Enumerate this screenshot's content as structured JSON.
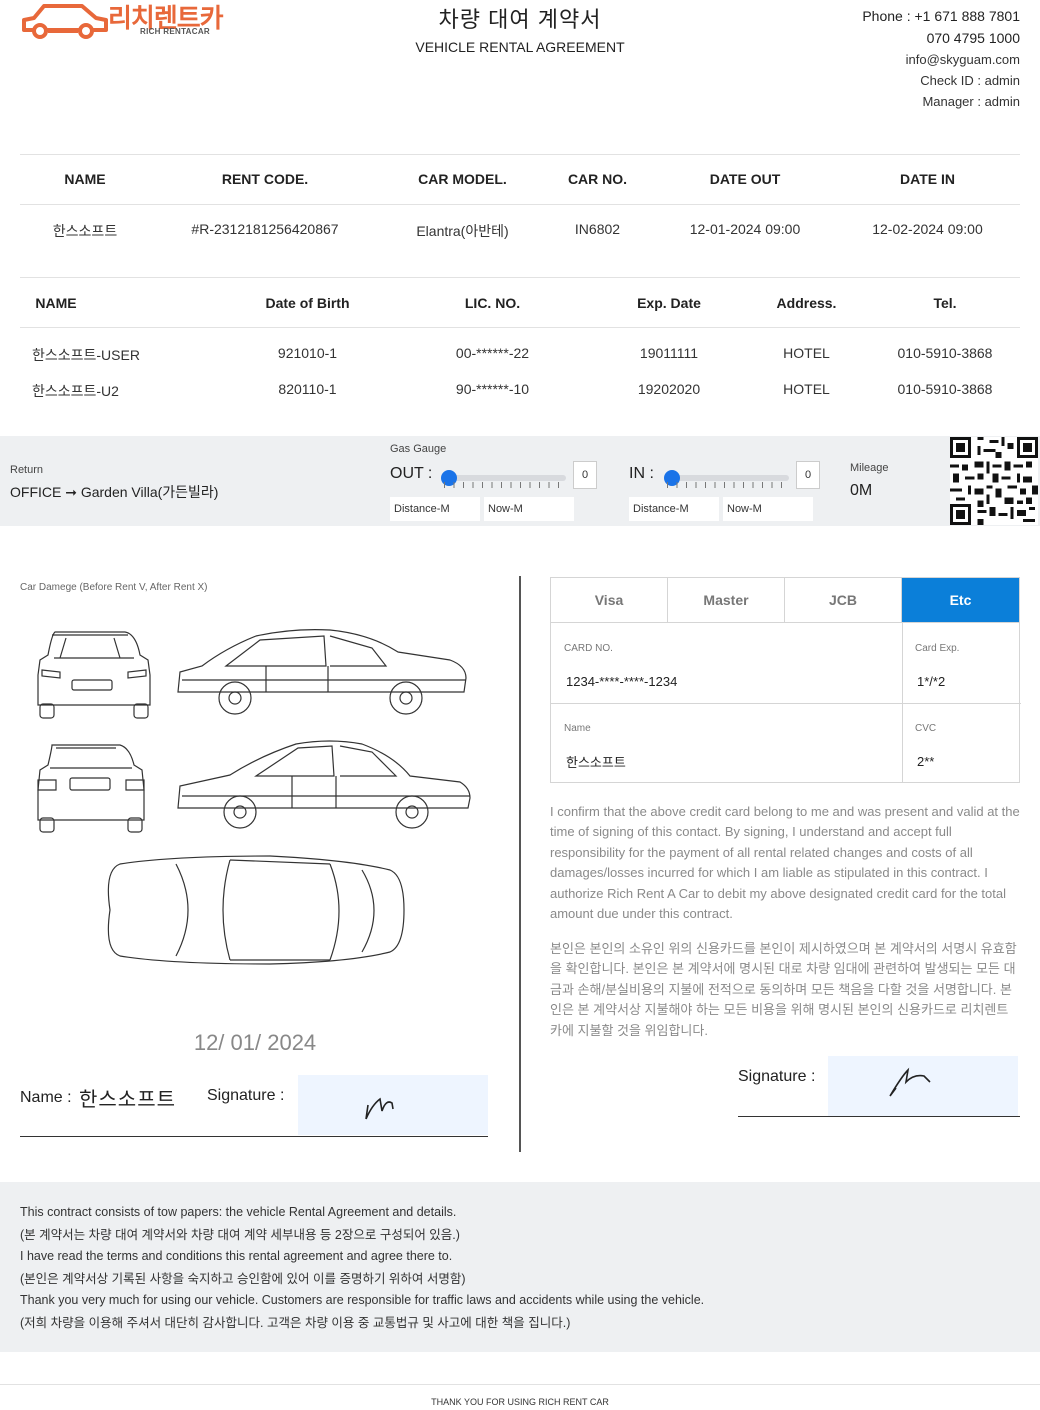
{
  "logo": {
    "kr": "리치렌트카",
    "en": "RICH RENTACAR"
  },
  "title": {
    "kr": "차량 대여 계약서",
    "en": "VEHICLE RENTAL AGREEMENT"
  },
  "contact": {
    "phone": "Phone : +1 671 888 7801",
    "phone2": "070 4795 1000",
    "email": "info@skyguam.com",
    "check_id": "Check ID : admin",
    "manager": "Manager : admin"
  },
  "rental_table": {
    "headers": [
      "NAME",
      "RENT CODE.",
      "CAR MODEL.",
      "CAR NO.",
      "DATE OUT",
      "DATE IN"
    ],
    "row": [
      "한스소프트",
      "#R-2312181256420867",
      "Elantra(아반테)",
      "IN6802",
      "12-01-2024 09:00",
      "12-02-2024 09:00"
    ]
  },
  "driver_table": {
    "headers": [
      "NAME",
      "Date of Birth",
      "LIC. NO.",
      "Exp. Date",
      "Address.",
      "Tel."
    ],
    "rows": [
      [
        "한스소프트-USER",
        "921010-1",
        "00-******-22",
        "19011111",
        "HOTEL",
        "010-5910-3868"
      ],
      [
        "한스소프트-U2",
        "820110-1",
        "90-******-10",
        "19202020",
        "HOTEL",
        "010-5910-3868"
      ]
    ]
  },
  "trip": {
    "return_label": "Return",
    "return_value": "OFFICE ➞ Garden Villa(가든빌라)",
    "gas_label": "Gas Gauge",
    "out_label": "OUT :",
    "in_label": "IN :",
    "out_value": "0",
    "in_value": "0",
    "out_fraction": 0,
    "in_fraction": 0,
    "distance_placeholder": "Distance-M",
    "now_placeholder": "Now-M",
    "mileage_label": "Mileage",
    "mileage_value": "0M"
  },
  "damage": {
    "label": "Car Damege (Before Rent V, After Rent X)",
    "date": "12/ 01/ 2024",
    "name_label": "Name :",
    "name_value": "한스소프트",
    "signature_label": "Signature :"
  },
  "card": {
    "tabs": [
      "Visa",
      "Master",
      "JCB",
      "Etc"
    ],
    "active_tab": "Etc",
    "card_no_label": "CARD NO.",
    "card_no": "1234-****-****-1234",
    "exp_label": "Card Exp.",
    "exp": "1*/*2",
    "name_label": "Name",
    "name": "한스소프트",
    "cvc_label": "CVC",
    "cvc": "2**",
    "active_color": "#0b7fd9"
  },
  "terms": {
    "en": "I confirm that the above credit card belong to me and was present and valid at the time of signing of this contact. By signing, I understand and accept full responsibility for the payment of all rental related changes and costs of all damages/losses incurred for which I am liable as stipulated in this contract. I authorize Rich Rent A Car to debit my above designated credit card for the total amount due under this contract.",
    "kr": "본인은 본인의 소유인 위의 신용카드를 본인이 제시하였으며 본 계약서의 서명시 유효함을 확인합니다. 본인은 본 계약서에 명시된 대로 차량 임대에 관련하여 발생되는 모든 대금과 손해/분실비용의 지불에 전적으로 동의하며 모든 책음을 다할 것을 서명합니다. 본인은 본 계약서상 지불해야 하는 모든 비용을 위해 명시된 본인의 신용카드로 리치렌트카에 지불할 것을 위임합니다.",
    "signature_label": "Signature :"
  },
  "footer": {
    "lines": [
      "This contract consists of tow papers: the vehicle Rental Agreement and details.",
      "(본 계약서는 차량 대여 계약서와 차량 대여 계약 세부내용 등 2장으로 구성되어 있음.)",
      "I have read the terms and conditions this rental agreement and agree there to.",
      "(본인은 계약서상 기록된 사항을 숙지하고 승인함에 있어 이를 증명하기 위하여 서명함)",
      "Thank you very much for using our vehicle. Customers are responsible for traffic laws and accidents while using the vehicle.",
      "(저희 차량을 이용해 주셔서 대단히 감사합니다. 고객은 차량 이용 중 교통법규 및 사고에 대한 책을 집니다.)"
    ],
    "thanks": "THANK YOU FOR USING RICH RENT CAR"
  }
}
